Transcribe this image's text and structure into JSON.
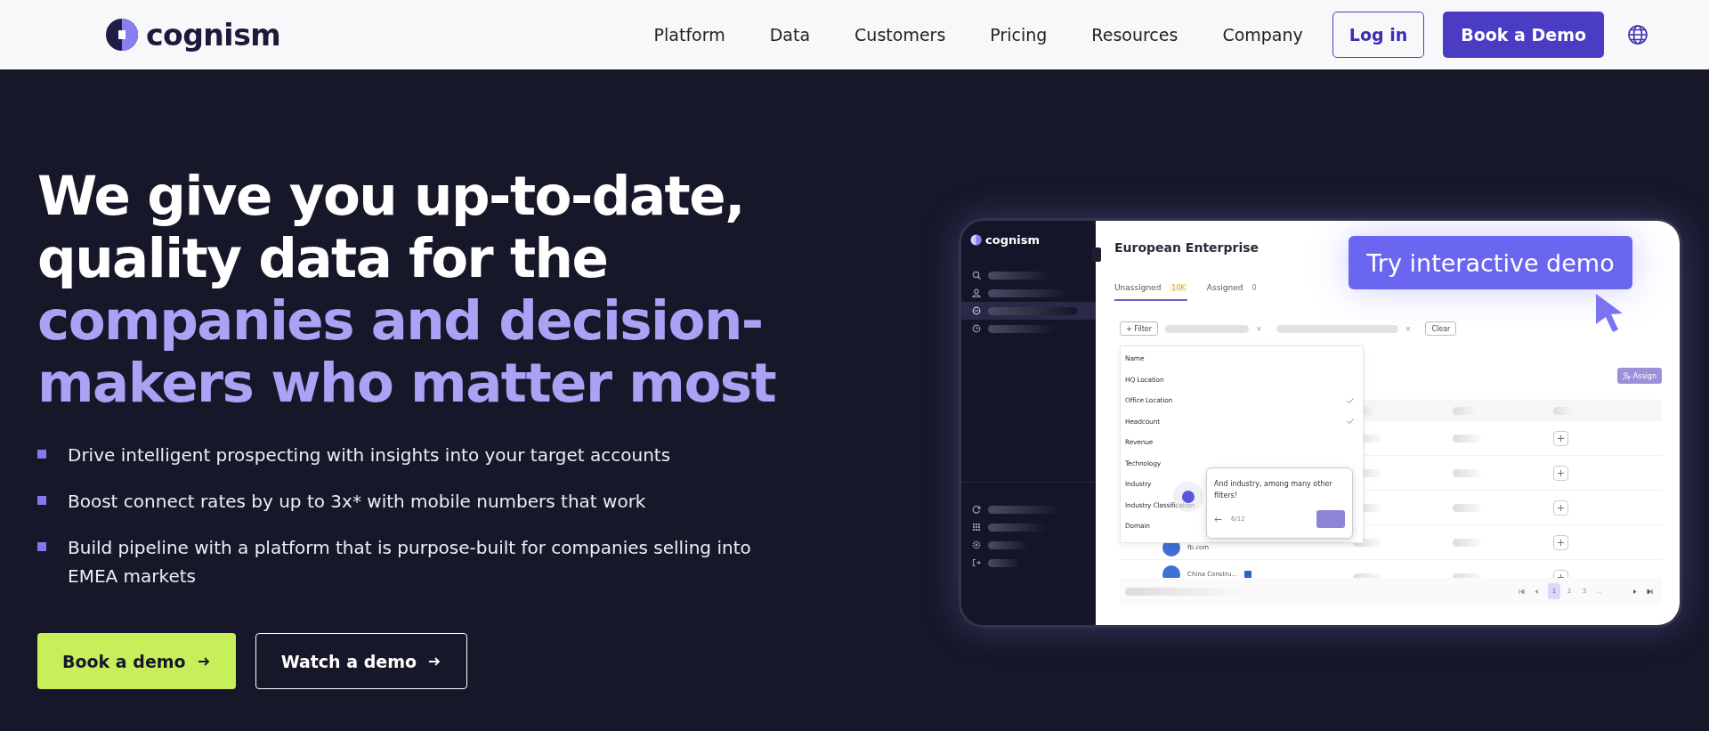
{
  "header": {
    "logo": "cognism",
    "nav": [
      "Platform",
      "Data",
      "Customers",
      "Pricing",
      "Resources",
      "Company"
    ],
    "login": "Log in",
    "cta": "Book a Demo"
  },
  "hero": {
    "headline_plain": "We give you up-to-date, quality data for the ",
    "headline_accent": "companies and decision-makers who matter most",
    "bullets": [
      "Drive intelligent prospecting with insights into your target accounts",
      "Boost connect rates by up to 3x* with mobile numbers that work",
      "Build pipeline with a platform that is purpose-built for companies selling into EMEA markets"
    ],
    "primary_button": "Book a demo",
    "secondary_button": "Watch a demo"
  },
  "demo": {
    "logo": "cognism",
    "sidebar_items": [
      {
        "selected": false
      },
      {
        "selected": false
      },
      {
        "selected": true
      },
      {
        "selected": false
      }
    ],
    "title": "European Enterprise",
    "tabs": [
      {
        "label": "Unassigned",
        "count": "10K",
        "selected": true
      },
      {
        "label": "Assigned",
        "count": "0",
        "selected": false
      }
    ],
    "filter_button": "+ Filter",
    "remove": "×",
    "clear": "Clear",
    "assign": "Assign",
    "filter_options": [
      {
        "label": "Name",
        "checked": false
      },
      {
        "label": "HQ Location",
        "checked": false
      },
      {
        "label": "Office Location",
        "checked": true
      },
      {
        "label": "Headcount",
        "checked": true
      },
      {
        "label": "Revenue",
        "checked": false
      },
      {
        "label": "Technology",
        "checked": false
      },
      {
        "label": "Industry",
        "checked": false
      },
      {
        "label": "Industry Classification",
        "checked": false
      },
      {
        "label": "Domain",
        "checked": false
      }
    ],
    "rows": [
      {
        "kind": "blank"
      },
      {
        "kind": "blank"
      },
      {
        "kind": "blank"
      },
      {
        "kind": "domain",
        "text": "fb.com"
      },
      {
        "kind": "company",
        "text": "China Constru..."
      }
    ],
    "tooltip": {
      "text": "And industry, among many other filters!",
      "step": "6/12"
    },
    "pages": [
      {
        "label": "1",
        "selected": true
      },
      {
        "label": "2",
        "selected": false
      },
      {
        "label": "3",
        "selected": false
      },
      {
        "label": "..",
        "selected": false
      }
    ],
    "try_button": "Try interactive demo"
  }
}
